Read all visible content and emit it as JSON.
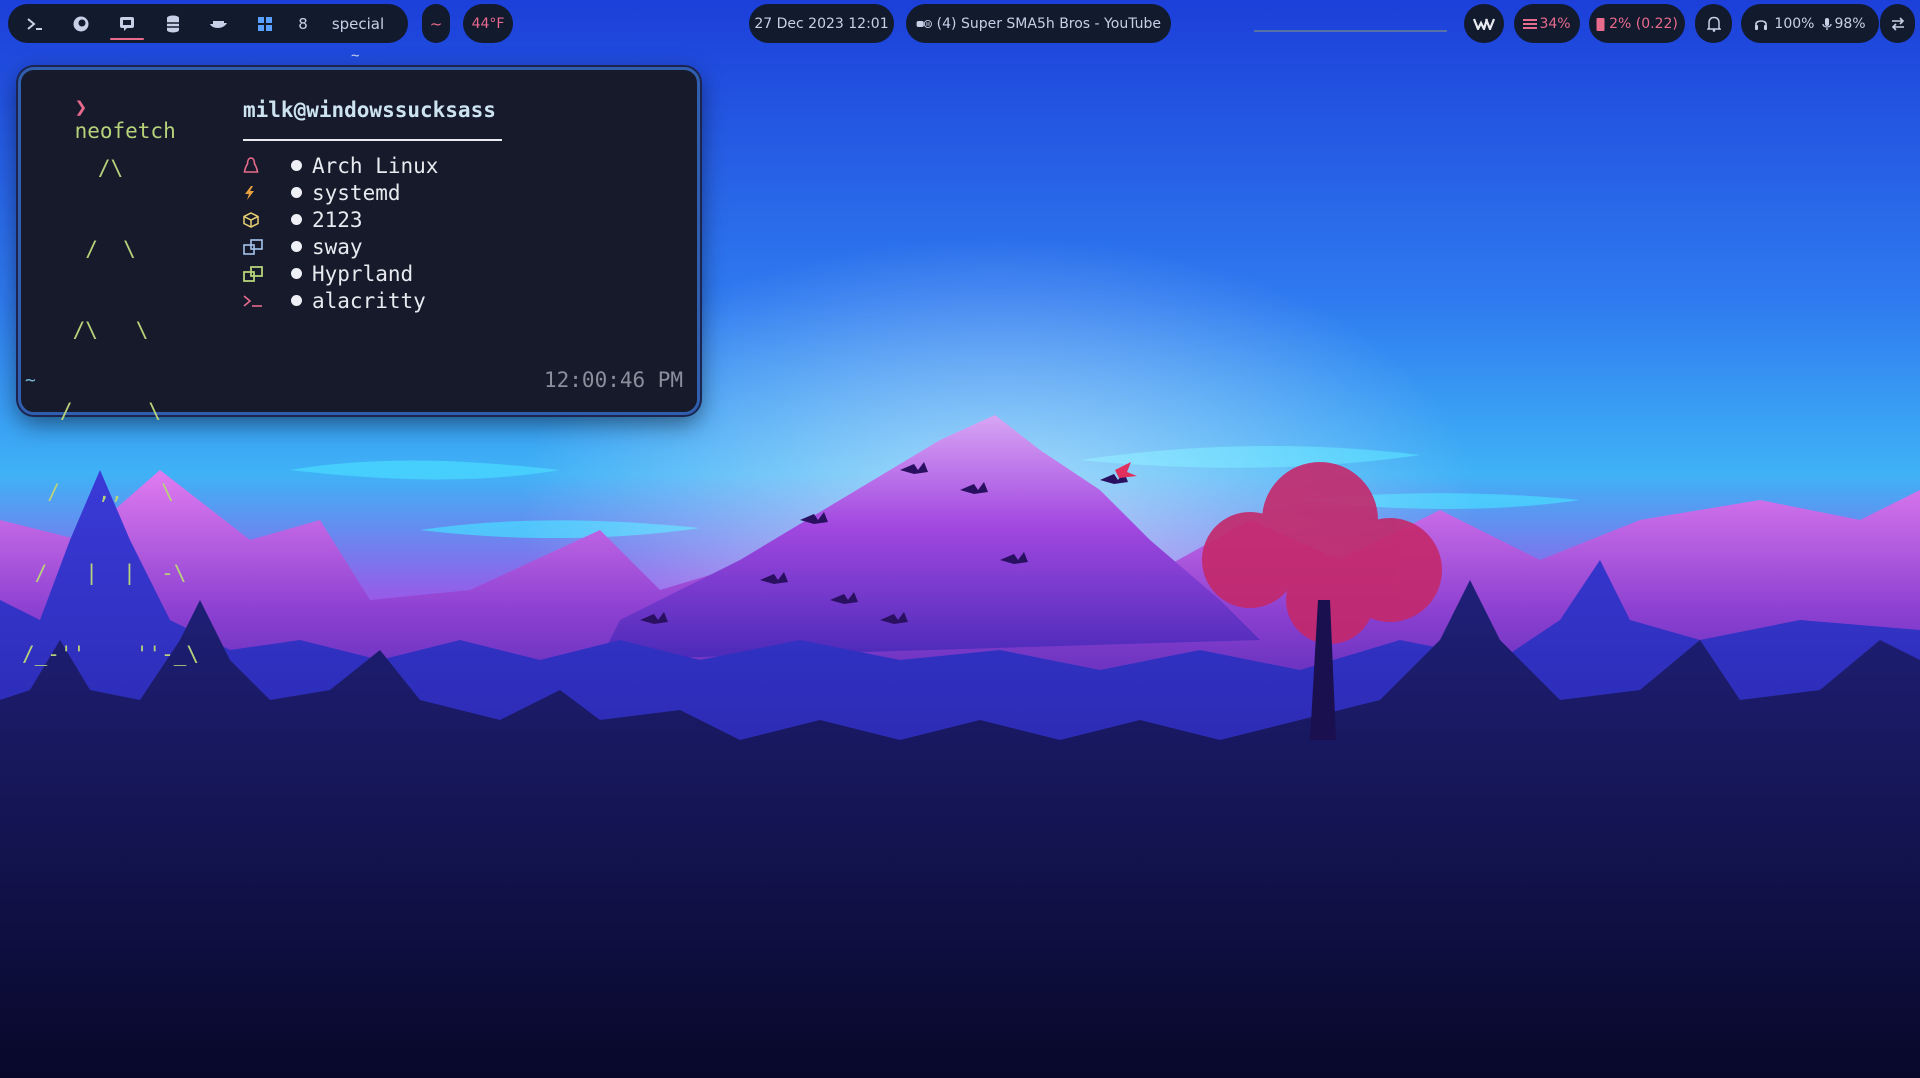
{
  "topbar": {
    "workspace_count_label": "8",
    "special_label": "special",
    "tilde_label": "~",
    "weather": "44°F",
    "datetime": "27 Dec 2023 12:01",
    "media_title": "(4) Super SMA5h Bros - YouTube",
    "memory": "34%",
    "cpu": "2% (0.22)",
    "volume": "100%",
    "mic": "98%"
  },
  "terminal": {
    "top_glyph": "~",
    "prompt_symbol": "❯",
    "command": "neofetch",
    "ascii_art": [
      "      /\\",
      "     /  \\",
      "    /\\   \\",
      "   /      \\",
      "  /   ,,   \\",
      " /   |  |  -\\",
      "/_-''    ''-_\\"
    ],
    "user_host": "milk@windowssucksass",
    "info": [
      {
        "icon": "linux-penguin-icon",
        "value": "Arch Linux"
      },
      {
        "icon": "init-bolt-icon",
        "value": "systemd"
      },
      {
        "icon": "package-icon",
        "value": "2123"
      },
      {
        "icon": "window-manager-icon",
        "value": "sway"
      },
      {
        "icon": "window-manager-icon",
        "value": "Hyprland"
      },
      {
        "icon": "terminal-icon",
        "value": "alacritty"
      }
    ],
    "cwd": "~",
    "clock": "12:00:46 PM"
  },
  "colors": {
    "bar_bg": "#121a2e",
    "accent_pink": "#e86a8c",
    "ascii_green": "#b7d27a",
    "terminal_bg": "#161a2a",
    "terminal_border": "#2f5fae"
  }
}
